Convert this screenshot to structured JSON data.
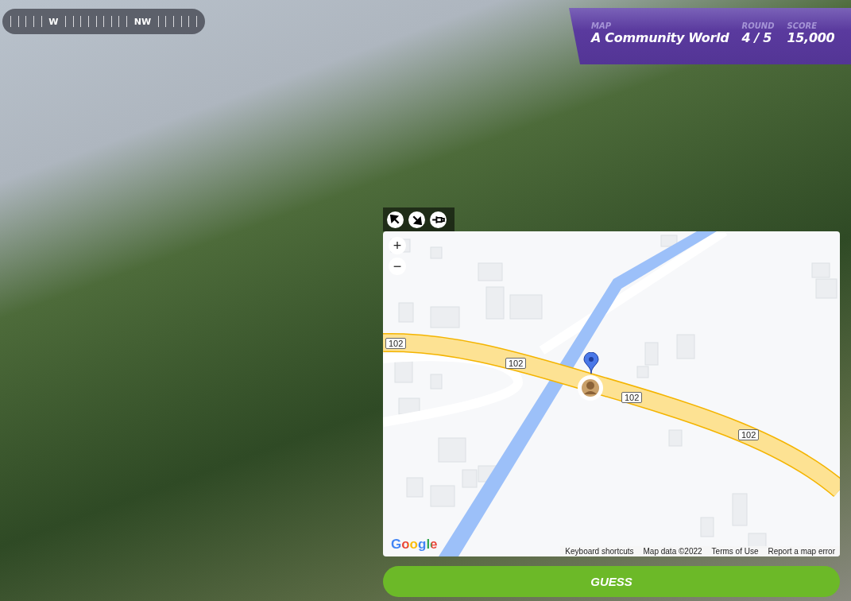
{
  "compass": {
    "labels": [
      "W",
      "NW"
    ]
  },
  "header": {
    "map_label": "MAP",
    "map_name": "A Community World",
    "round_label": "ROUND",
    "round": "4 / 5",
    "score_label": "SCORE",
    "score": "15,000"
  },
  "map": {
    "zoom_in": "+",
    "zoom_out": "−",
    "road_labels": [
      "102",
      "102",
      "102",
      "102"
    ],
    "logo": "Google",
    "footer_links": [
      "Keyboard shortcuts",
      "Map data ©2022",
      "Terms of Use",
      "Report a map error"
    ]
  },
  "guess_button": "GUESS"
}
